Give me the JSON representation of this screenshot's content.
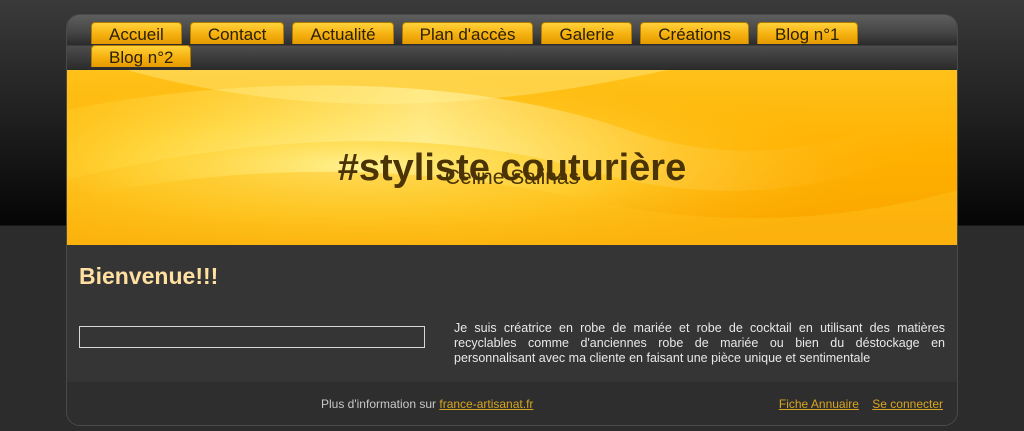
{
  "nav": {
    "items": [
      {
        "label": "Accueil"
      },
      {
        "label": "Contact"
      },
      {
        "label": "Actualité"
      },
      {
        "label": "Plan d'accès"
      },
      {
        "label": "Galerie"
      },
      {
        "label": "Créations"
      },
      {
        "label": "Blog n°1"
      },
      {
        "label": "Blog n°2"
      }
    ]
  },
  "banner": {
    "title": "#styliste couturière",
    "subtitle": "Celine Salinas"
  },
  "content": {
    "heading": "Bienvenue!!!",
    "description": "Je suis créatrice en robe de mariée et robe de cocktail en utilisant des matières recyclables comme d'anciennes robe de mariée ou bien du déstockage en personnalisant avec ma cliente en faisant une pièce unique et sentimentale"
  },
  "footer": {
    "info_text": "Plus d'information sur",
    "info_link": "france-artisanat.fr",
    "directory_link": "Fiche Annuaire",
    "login_link": "Se connecter"
  },
  "colors": {
    "tab_gold": "#f5b010",
    "heading_cream": "#ffe0a0",
    "link_gold": "#d9a520",
    "panel_dark": "#353535"
  }
}
